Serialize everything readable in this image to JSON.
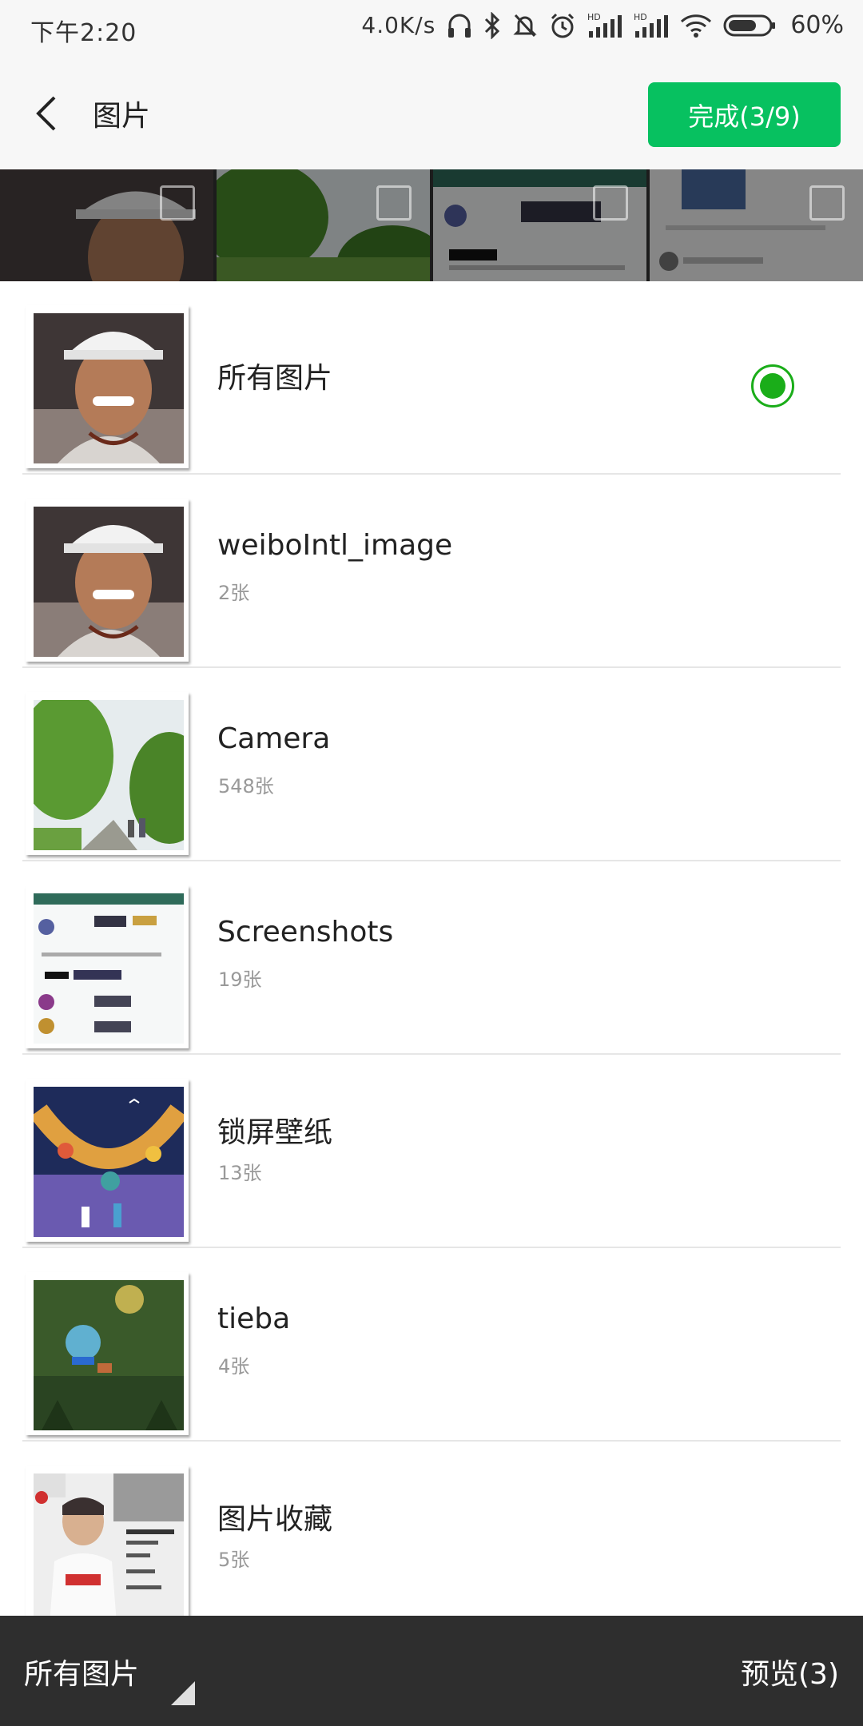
{
  "status_bar": {
    "time": "下午2:20",
    "net_speed": "4.0K/s",
    "battery": "60%"
  },
  "header": {
    "title": "图片",
    "done_label": "完成(3/9)"
  },
  "albums": [
    {
      "name": "所有图片",
      "count": "",
      "selected": true
    },
    {
      "name": "weiboIntl_image",
      "count": "2张"
    },
    {
      "name": "Camera",
      "count": "548张"
    },
    {
      "name": "Screenshots",
      "count": "19张"
    },
    {
      "name": "锁屏壁纸",
      "count": "13张"
    },
    {
      "name": "tieba",
      "count": "4张"
    },
    {
      "name": "图片收藏",
      "count": "5张"
    }
  ],
  "bottom_bar": {
    "album_selector": "所有图片",
    "preview_label": "预览(3)"
  },
  "colors": {
    "accent": "#07c160",
    "radio": "#1aad19",
    "bottom_bar": "#2e2e2e"
  }
}
